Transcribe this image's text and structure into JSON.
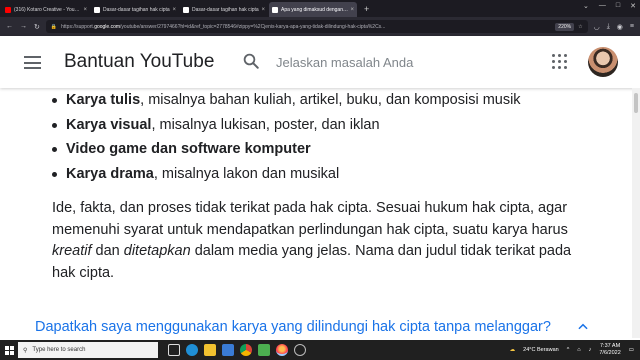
{
  "browser": {
    "tabs": [
      {
        "title": "(316) Kotaro Creative - YouTube",
        "color": "#ff0000",
        "active": false
      },
      {
        "title": "Dasar-dasar tagihan hak cipta",
        "color": "#ffffff",
        "active": false
      },
      {
        "title": "Dasar-dasar tagihan hak cipta",
        "color": "#ffffff",
        "active": false
      },
      {
        "title": "Apa yang dimaksud dengan hak",
        "color": "#ffffff",
        "active": true
      }
    ],
    "url_prefix": "https://support.",
    "url_domain": "google.com",
    "url_rest": "/youtube/answer/2797466?hl=id&ref_topic=2778546#zippy=%2Cjenis-karya-apa-yang-tidak-dilindungi-hak-cipta%2Cs...",
    "zoom": "220%"
  },
  "header": {
    "title": "Bantuan YouTube",
    "search_placeholder": "Jelaskan masalah Anda"
  },
  "content": {
    "bullets": [
      {
        "bold": "Karya tulis",
        "rest": ", misalnya bahan kuliah, artikel, buku, dan komposisi musik"
      },
      {
        "bold": "Karya visual",
        "rest": ", misalnya lukisan, poster, dan iklan"
      },
      {
        "bold": "Video game dan software komputer",
        "rest": ""
      },
      {
        "bold": "Karya drama",
        "rest": ", misalnya lakon dan musikal"
      }
    ],
    "paragraph": {
      "p1": "Ide, fakta, dan proses tidak terikat pada hak cipta. Sesuai hukum hak cipta, agar memenuhi syarat untuk mendapatkan perlindungan hak cipta, suatu karya harus ",
      "em1": "kreatif",
      "p2": " dan ",
      "em2": "ditetapkan",
      "p3": " dalam media yang jelas. Nama dan judul tidak terikat pada hak cipta."
    },
    "faq_question": "Dapatkah saya menggunakan karya yang dilindungi hak cipta tanpa melanggar?"
  },
  "taskbar": {
    "search_placeholder": "Type here to search",
    "weather": "24°C  Berawan",
    "time": "7:37 AM",
    "date": "7/6/2022"
  }
}
